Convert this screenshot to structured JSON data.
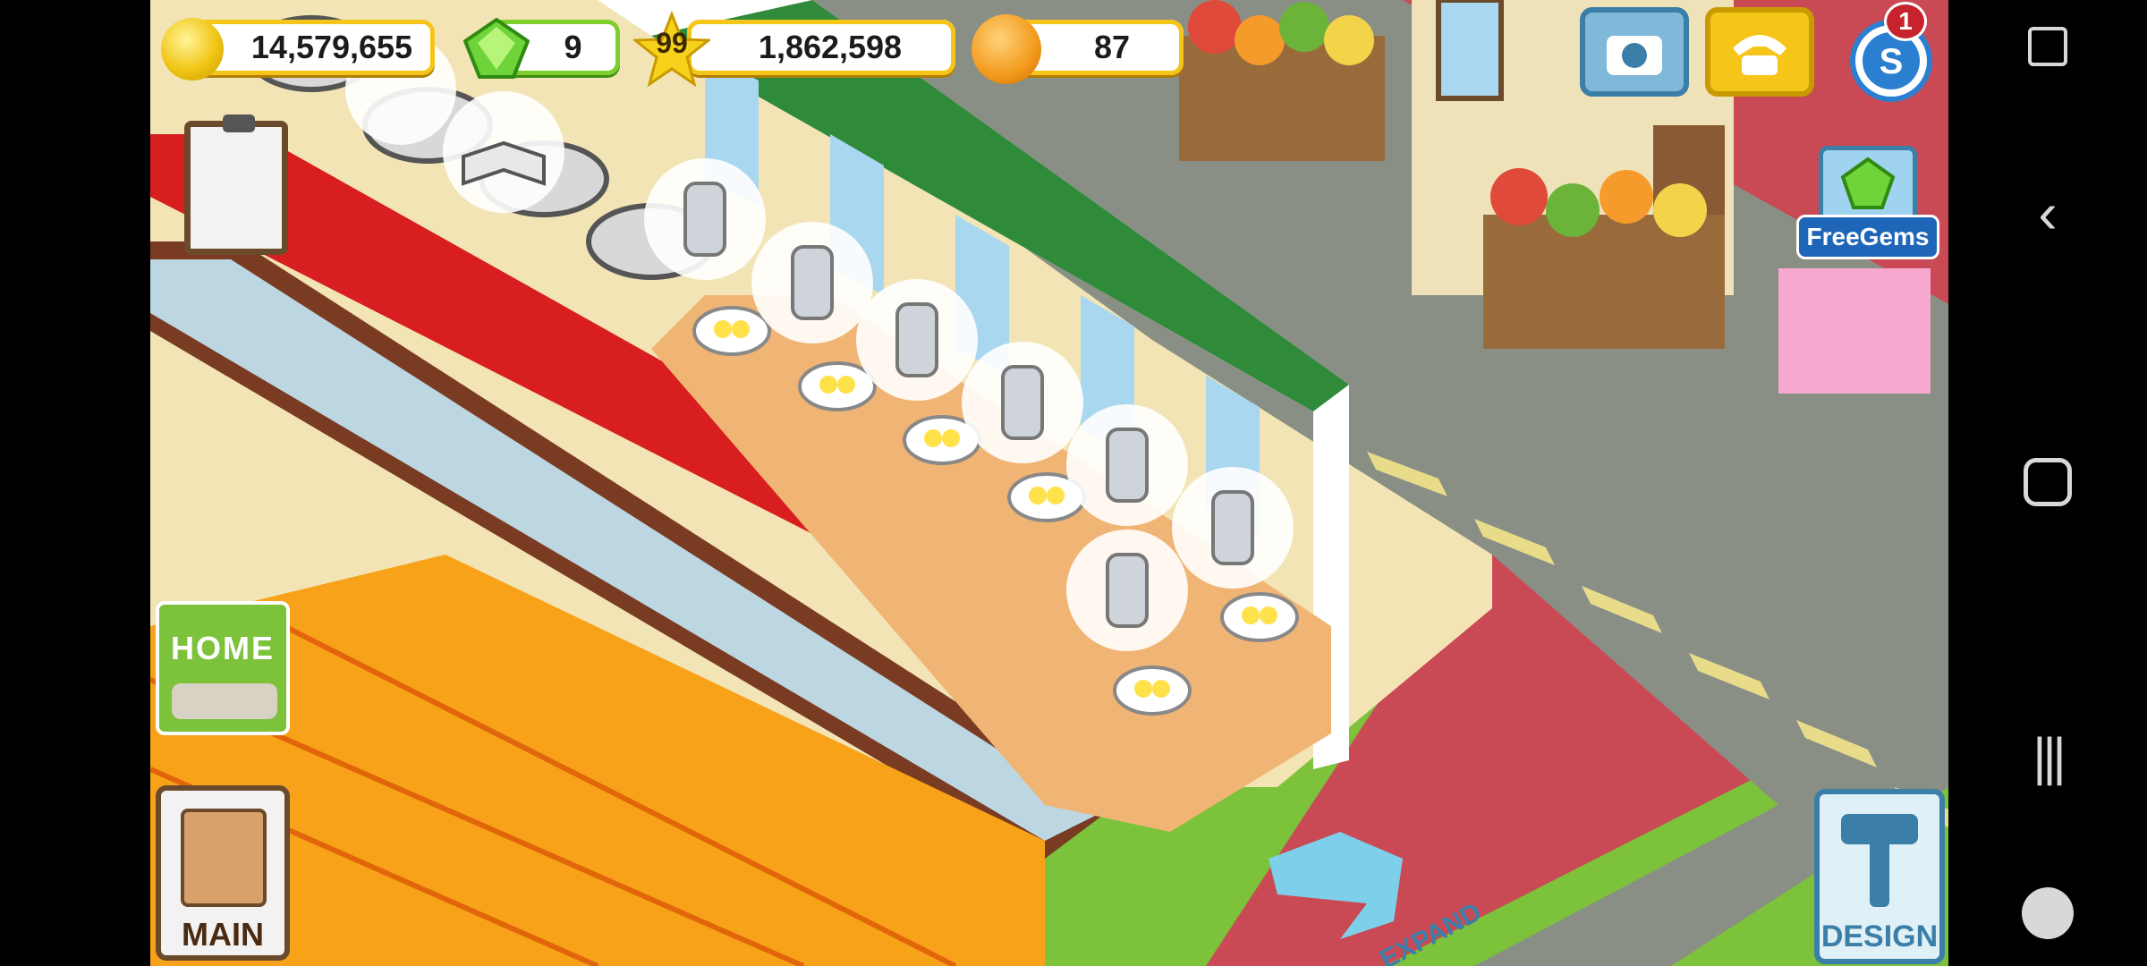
{
  "hud": {
    "coins": "14,579,655",
    "gems": "9",
    "level": "99",
    "experience": "1,862,598",
    "fans": "87",
    "notification_count": "1"
  },
  "buttons": {
    "free_gems": "FreeGems",
    "home": "HOME",
    "main": "MAIN",
    "design": "DESIGN",
    "expand": "EXPAND"
  },
  "colors": {
    "coin_gold": "#f6c51a",
    "gem_green": "#7fcf2c",
    "grass": "#7cc23a",
    "road": "#8a8f86",
    "brick": "#c94a55",
    "counter_red": "#d81e1e"
  }
}
